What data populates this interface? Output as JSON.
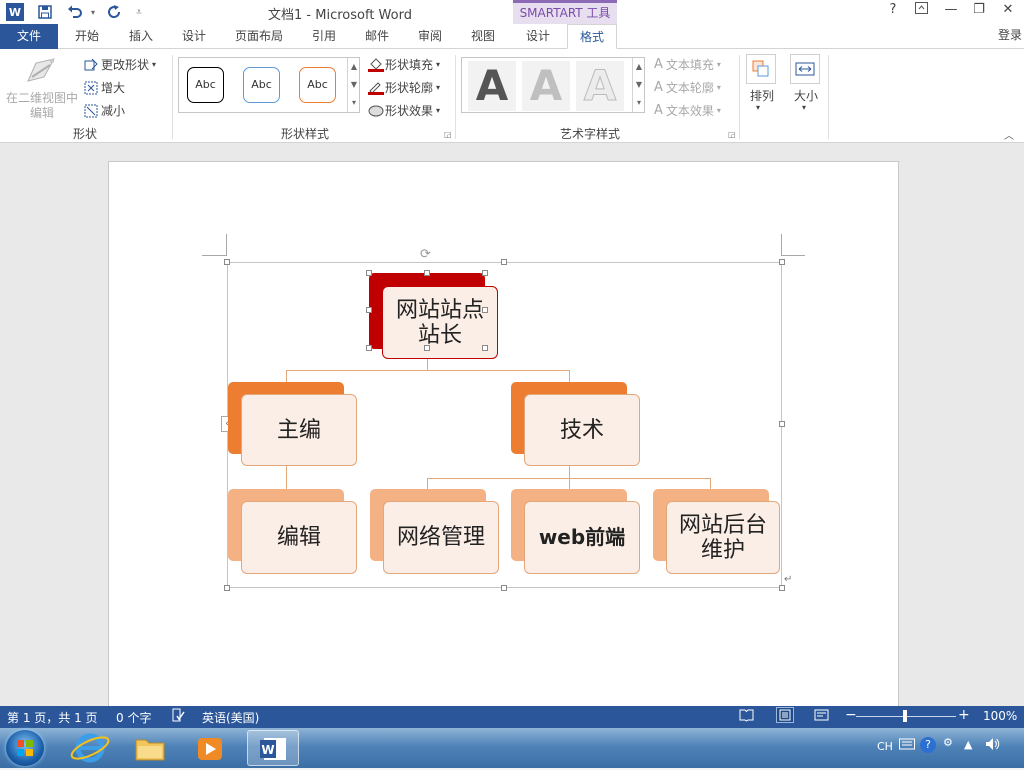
{
  "title_bar": {
    "document_title": "文档1 - Microsoft Word",
    "contextual_tab_group": "SMARTART 工具",
    "quick_access": [
      {
        "name": "word-logo-icon",
        "glyph": "W"
      },
      {
        "name": "save-icon",
        "glyph": "💾"
      },
      {
        "name": "undo-icon",
        "glyph": "↶"
      },
      {
        "name": "redo-icon",
        "glyph": "↻"
      },
      {
        "name": "customize-qat-icon",
        "glyph": "⩡"
      }
    ],
    "window_buttons": {
      "help": "?",
      "ribbon_display": "⊡",
      "minimize": "—",
      "restore": "❐",
      "close": "✕"
    }
  },
  "tabs": [
    {
      "label": "文件",
      "id": "file"
    },
    {
      "label": "开始",
      "id": "home"
    },
    {
      "label": "插入",
      "id": "insert"
    },
    {
      "label": "设计",
      "id": "design"
    },
    {
      "label": "页面布局",
      "id": "layout"
    },
    {
      "label": "引用",
      "id": "references"
    },
    {
      "label": "邮件",
      "id": "mailings"
    },
    {
      "label": "审阅",
      "id": "review"
    },
    {
      "label": "视图",
      "id": "view"
    },
    {
      "label": "设计",
      "id": "sa-design"
    },
    {
      "label": "格式",
      "id": "sa-format",
      "active": true
    }
  ],
  "signin_label": "登录",
  "ribbon": {
    "shapes_group": {
      "label": "形状",
      "edit_in_2d": "在二维视图中编辑",
      "change_shape": "更改形状",
      "larger": "增大",
      "smaller": "减小"
    },
    "shape_styles_group": {
      "label": "形状样式",
      "gallery": [
        {
          "text": "Abc",
          "border": "#000000"
        },
        {
          "text": "Abc",
          "border": "#5b9bd5"
        },
        {
          "text": "Abc",
          "border": "#ed7d31"
        }
      ],
      "fill": "形状填充",
      "outline": "形状轮廓",
      "effects": "形状效果"
    },
    "wordart_group": {
      "label": "艺术字样式",
      "letters": [
        "A",
        "A",
        "A"
      ],
      "text_fill": "文本填充",
      "text_outline": "文本轮廓",
      "text_effects": "文本效果"
    },
    "arrange": "排列",
    "size": "大小"
  },
  "smartart": {
    "root": {
      "text": "网站站点站长",
      "lines": [
        "网站站点",
        "站长"
      ]
    },
    "level2": [
      {
        "text": "主编"
      },
      {
        "text": "技术"
      }
    ],
    "level3": [
      {
        "text": "编辑",
        "lines": [
          "编辑"
        ]
      },
      {
        "text": "网络管理",
        "lines": [
          "网络管理"
        ]
      },
      {
        "text": "web前端",
        "lines": [
          "web前端"
        ]
      },
      {
        "text": "网站后台维护",
        "lines": [
          "网站后台",
          "维护"
        ]
      }
    ],
    "colors": {
      "root_back": "#c00000",
      "root_front_border": "#c00000",
      "level2_back": "#ed7d31",
      "level2_border": "#e3a77c",
      "level3_back": "#f4b183",
      "front_fill": "#fbeee6"
    }
  },
  "status_bar": {
    "page": "第 1 页，共 1 页",
    "words": "0 个字",
    "language": "英语(美国)",
    "zoom": "100%"
  },
  "taskbar": {
    "tray": {
      "ime": "CH"
    }
  }
}
